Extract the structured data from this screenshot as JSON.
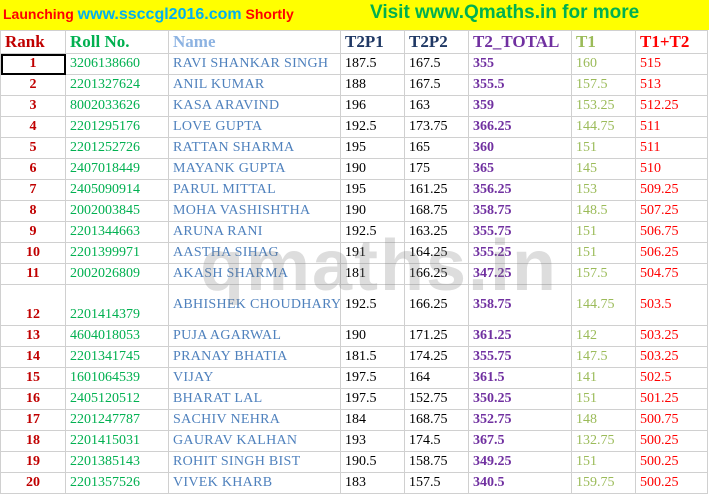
{
  "banner": {
    "launch_prefix": "Launching ",
    "launch_site": "www.ssccgl2016.com",
    "launch_suffix": " Shortly",
    "visit_text": "Visit www.Qmaths.in for more"
  },
  "watermark": "qmaths.in",
  "columns": [
    "Rank",
    "Roll No.",
    "Name",
    "T2P1",
    "T2P2",
    "T2_TOTAL",
    "T1",
    "T1+T2"
  ],
  "rows": [
    {
      "rank": "1",
      "roll": "3206138660",
      "name": "RAVI SHANKAR SINGH",
      "t2p1": "187.5",
      "t2p2": "167.5",
      "total": "355",
      "t1": "160",
      "sum": "515"
    },
    {
      "rank": "2",
      "roll": "2201327624",
      "name": "ANIL KUMAR",
      "t2p1": "188",
      "t2p2": "167.5",
      "total": "355.5",
      "t1": "157.5",
      "sum": "513"
    },
    {
      "rank": "3",
      "roll": "8002033626",
      "name": "KASA ARAVIND",
      "t2p1": "196",
      "t2p2": "163",
      "total": "359",
      "t1": "153.25",
      "sum": "512.25"
    },
    {
      "rank": "4",
      "roll": "2201295176",
      "name": "LOVE GUPTA",
      "t2p1": "192.5",
      "t2p2": "173.75",
      "total": "366.25",
      "t1": "144.75",
      "sum": "511"
    },
    {
      "rank": "5",
      "roll": "2201252726",
      "name": "RATTAN SHARMA",
      "t2p1": "195",
      "t2p2": "165",
      "total": "360",
      "t1": "151",
      "sum": "511"
    },
    {
      "rank": "6",
      "roll": "2407018449",
      "name": "MAYANK GUPTA",
      "t2p1": "190",
      "t2p2": "175",
      "total": "365",
      "t1": "145",
      "sum": "510"
    },
    {
      "rank": "7",
      "roll": "2405090914",
      "name": "PARUL MITTAL",
      "t2p1": "195",
      "t2p2": "161.25",
      "total": "356.25",
      "t1": "153",
      "sum": "509.25"
    },
    {
      "rank": "8",
      "roll": "2002003845",
      "name": "MOHA VASHISHTHA",
      "t2p1": "190",
      "t2p2": "168.75",
      "total": "358.75",
      "t1": "148.5",
      "sum": "507.25"
    },
    {
      "rank": "9",
      "roll": "2201344663",
      "name": "ARUNA RANI",
      "t2p1": "192.5",
      "t2p2": "163.25",
      "total": "355.75",
      "t1": "151",
      "sum": "506.75"
    },
    {
      "rank": "10",
      "roll": "2201399971",
      "name": "AASTHA SIHAG",
      "t2p1": "191",
      "t2p2": "164.25",
      "total": "355.25",
      "t1": "151",
      "sum": "506.25"
    },
    {
      "rank": "11",
      "roll": "2002026809",
      "name": "AKASH SHARMA",
      "t2p1": "181",
      "t2p2": "166.25",
      "total": "347.25",
      "t1": "157.5",
      "sum": "504.75"
    },
    {
      "rank": "12",
      "roll": "2201414379",
      "name": "ABHISHEK CHOUDHARY",
      "t2p1": "192.5",
      "t2p2": "166.25",
      "total": "358.75",
      "t1": "144.75",
      "sum": "503.5"
    },
    {
      "rank": "13",
      "roll": "4604018053",
      "name": "PUJA AGARWAL",
      "t2p1": "190",
      "t2p2": "171.25",
      "total": "361.25",
      "t1": "142",
      "sum": "503.25"
    },
    {
      "rank": "14",
      "roll": "2201341745",
      "name": "PRANAY BHATIA",
      "t2p1": "181.5",
      "t2p2": "174.25",
      "total": "355.75",
      "t1": "147.5",
      "sum": "503.25"
    },
    {
      "rank": "15",
      "roll": "1601064539",
      "name": "VIJAY",
      "t2p1": "197.5",
      "t2p2": "164",
      "total": "361.5",
      "t1": "141",
      "sum": "502.5"
    },
    {
      "rank": "16",
      "roll": "2405120512",
      "name": "BHARAT LAL",
      "t2p1": "197.5",
      "t2p2": "152.75",
      "total": "350.25",
      "t1": "151",
      "sum": "501.25"
    },
    {
      "rank": "17",
      "roll": "2201247787",
      "name": "SACHIV NEHRA",
      "t2p1": "184",
      "t2p2": "168.75",
      "total": "352.75",
      "t1": "148",
      "sum": "500.75"
    },
    {
      "rank": "18",
      "roll": "2201415031",
      "name": "GAURAV KALHAN",
      "t2p1": "193",
      "t2p2": "174.5",
      "total": "367.5",
      "t1": "132.75",
      "sum": "500.25"
    },
    {
      "rank": "19",
      "roll": "2201385143",
      "name": "ROHIT SINGH BIST",
      "t2p1": "190.5",
      "t2p2": "158.75",
      "total": "349.25",
      "t1": "151",
      "sum": "500.25"
    },
    {
      "rank": "20",
      "roll": "2201357526",
      "name": "VIVEK KHARB",
      "t2p1": "183",
      "t2p2": "157.5",
      "total": "340.5",
      "t1": "159.75",
      "sum": "500.25"
    }
  ]
}
